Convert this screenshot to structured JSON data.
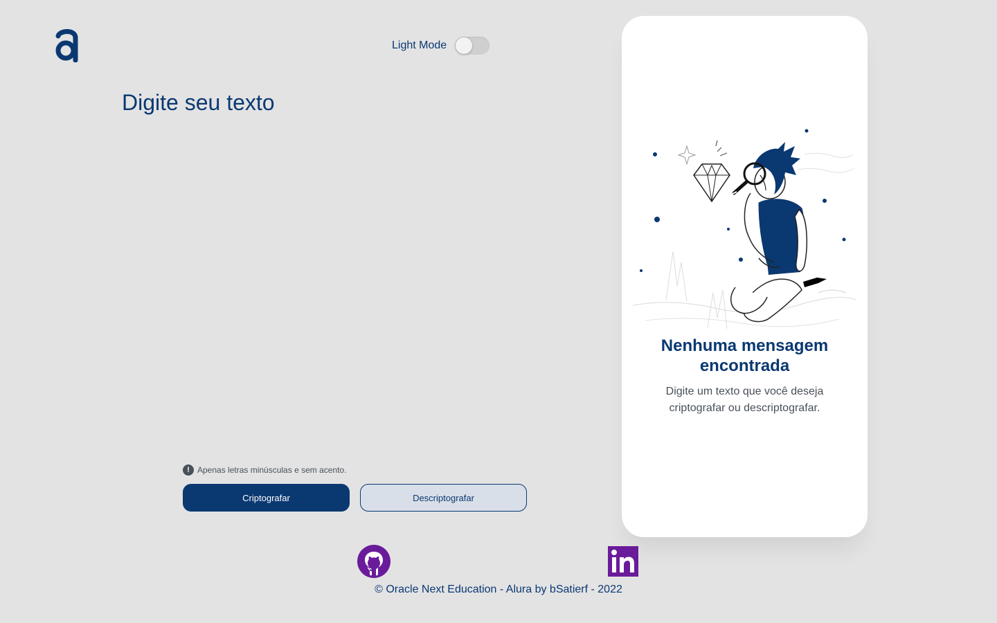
{
  "header": {
    "logo_icon": "alura-logo-icon",
    "toggle_label": "Light Mode",
    "toggle_on": false
  },
  "input": {
    "placeholder": "Digite seu texto",
    "value": ""
  },
  "hint": {
    "icon": "exclamation-circle-icon",
    "text": "Apenas letras minúsculas e sem acento."
  },
  "buttons": {
    "encrypt_label": "Criptografar",
    "decrypt_label": "Descriptografar"
  },
  "output_card": {
    "illustration": "person-magnifying-glass-illustration",
    "title": "Nenhuma mensagem encontrada",
    "text": "Digite um texto que você deseja criptografar ou descriptografar."
  },
  "footer": {
    "github_icon": "github-icon",
    "linkedin_icon": "linkedin-icon",
    "text": "© Oracle Next Education - Alura by bSatierf - 2022"
  },
  "colors": {
    "background": "#e3e3e4",
    "primary": "#0a3871",
    "secondary_button": "#d8dfe8",
    "card": "#ffffff",
    "social": "#6a1b9a"
  }
}
